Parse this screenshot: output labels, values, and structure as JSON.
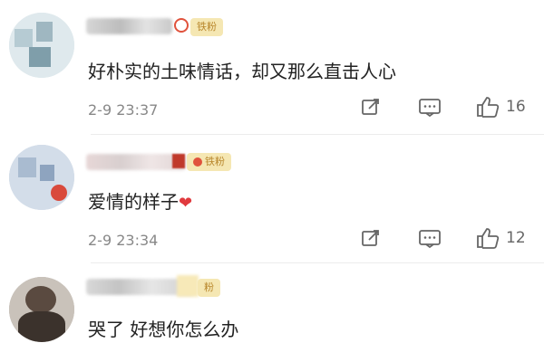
{
  "comments": [
    {
      "badge": "铁粉",
      "content": "好朴实的土味情话，却又那么直击人心",
      "time": "2-9 23:37",
      "likes": "16"
    },
    {
      "badge": "铁粉",
      "content": "爱情的样子",
      "time": "2-9 23:34",
      "likes": "12"
    },
    {
      "badge": "粉",
      "content": "哭了 好想你怎么办"
    }
  ],
  "icons": {
    "repost": "repost-icon",
    "comment": "comment-icon",
    "like": "thumbs-up-icon",
    "heart": "heart-emoji"
  },
  "colors": {
    "badge_bg": "#f5e7b3",
    "badge_text": "#b8862b",
    "heart": "#e03a3e"
  }
}
